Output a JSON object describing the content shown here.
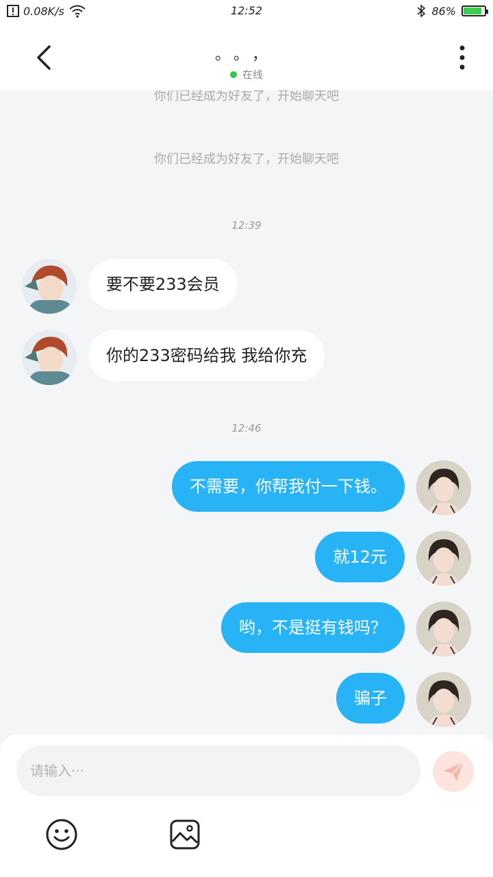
{
  "status_bar": {
    "speed": "0.08K/s",
    "time": "12:52",
    "battery": "86%",
    "battery_level": 0.86
  },
  "header": {
    "title": "。。，",
    "status": "在线"
  },
  "messages": {
    "system_1": "你们已经成为好友了，开始聊天吧",
    "system_2": "你们已经成为好友了，开始聊天吧",
    "time_1": "12:39",
    "in_1": "要不要233会员",
    "in_2": "你的233密码给我 我给你充",
    "time_2": "12:46",
    "out_1": "不需要，你帮我付一下钱。",
    "out_2": "就12元",
    "out_3": "哟，不是挺有钱吗？",
    "out_4": "骗子"
  },
  "composer": {
    "placeholder": "请输入···"
  },
  "icons": {
    "back": "chevron-left-icon",
    "more": "more-vertical-icon",
    "send": "send-icon",
    "emoji": "smiley-icon",
    "image": "image-icon"
  },
  "colors": {
    "outgoing_bubble": "#27b3f5",
    "incoming_bubble": "#ffffff",
    "online_dot": "#2fc84a",
    "send_button": "#fde4df"
  }
}
